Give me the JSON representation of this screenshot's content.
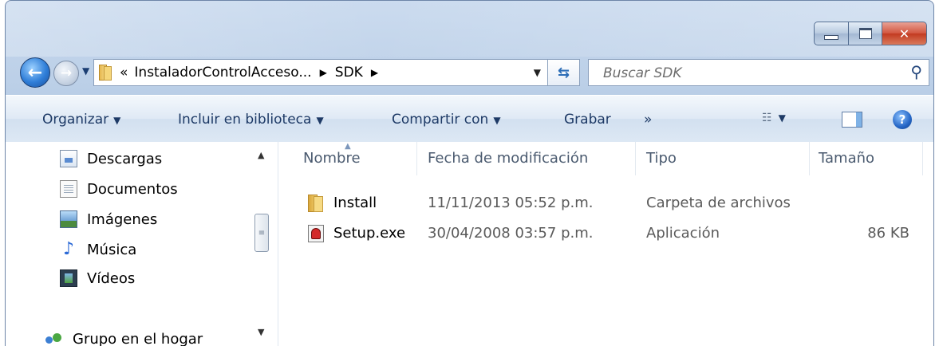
{
  "window": {
    "controls": {
      "minimize_icon": "minimize-icon",
      "maximize_icon": "maximize-icon",
      "close_label": "✕"
    }
  },
  "nav": {
    "breadcrumbs": [
      "«",
      "InstaladorControlAcceso...",
      "SDK"
    ],
    "search_placeholder": "Buscar SDK"
  },
  "toolbar": {
    "organizar": "Organizar",
    "incluir": "Incluir en biblioteca",
    "compartir": "Compartir con",
    "grabar": "Grabar",
    "more": "»"
  },
  "sidebar": {
    "items": [
      {
        "label": "Descargas",
        "icon": "downloads-icon"
      },
      {
        "label": "Documentos",
        "icon": "documents-icon"
      },
      {
        "label": "Imágenes",
        "icon": "pictures-icon"
      },
      {
        "label": "Música",
        "icon": "music-icon"
      },
      {
        "label": "Vídeos",
        "icon": "videos-icon"
      },
      {
        "label": "Grupo en el hogar",
        "icon": "homegroup-icon"
      }
    ]
  },
  "files": {
    "columns": [
      "Nombre",
      "Fecha de modificación",
      "Tipo",
      "Tamaño"
    ],
    "rows": [
      {
        "name": "Install",
        "date": "11/11/2013 05:52 p.m.",
        "type": "Carpeta de archivos",
        "size": "",
        "icon": "folder-icon"
      },
      {
        "name": "Setup.exe",
        "date": "30/04/2008 03:57 p.m.",
        "type": "Aplicación",
        "size": "86 KB",
        "icon": "application-icon"
      }
    ]
  },
  "colors": {
    "frame": "#b3c9e3",
    "toolbar_text": "#1e3a66",
    "close_button": "#c23a20"
  }
}
